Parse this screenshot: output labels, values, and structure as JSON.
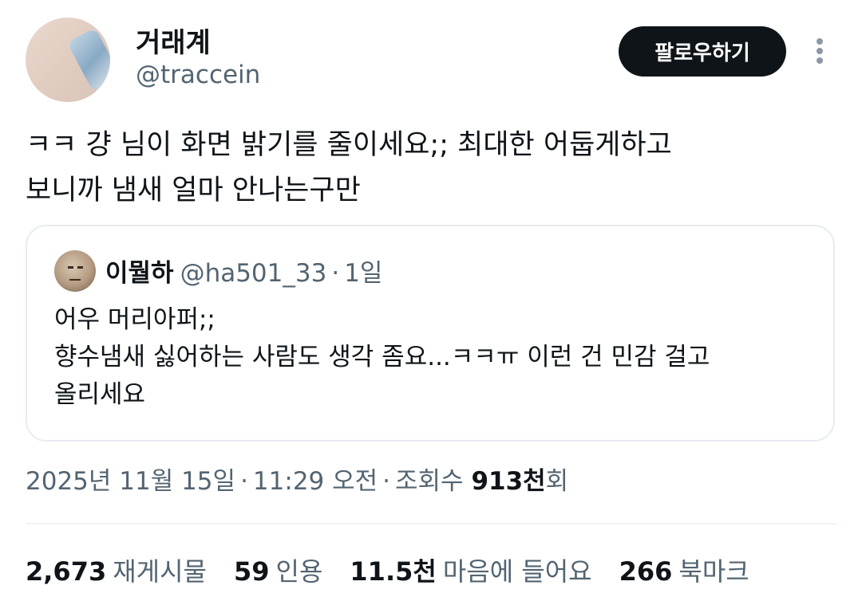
{
  "author": {
    "display_name": "거래계",
    "handle": "@traccein"
  },
  "follow_button_label": "팔로우하기",
  "more_icon": "more-vertical-icon",
  "tweet": {
    "text": "ㅋㅋ 걍 님이 화면 밝기를 줄이세요;; 최대한 어둡게하고\n보니까 냄새 얼마 안나는구만"
  },
  "quote": {
    "display_name": "이뭘하",
    "handle": "@ha501_33",
    "separator": "·",
    "time": "1일",
    "text": "어우 머리아퍼;;\n향수냄새 싫어하는 사람도 생각 좀요...ㅋㅋㅠ 이런 건 민감 걸고\n올리세요"
  },
  "meta": {
    "date": "2025년 11월 15일",
    "separator": "·",
    "time": "11:29 오전",
    "views_label": "조회수",
    "views_count": "913천",
    "views_unit": "회"
  },
  "stats": [
    {
      "num": "2,673",
      "label": "재게시물"
    },
    {
      "num": "59",
      "label": "인용"
    },
    {
      "num": "11.5천",
      "label": "마음에 들어요"
    },
    {
      "num": "266",
      "label": "북마크"
    }
  ],
  "colors": {
    "text_primary": "#0f1419",
    "text_secondary": "#536471",
    "button_bg": "#0f1419",
    "border": "#e6ecf0"
  }
}
